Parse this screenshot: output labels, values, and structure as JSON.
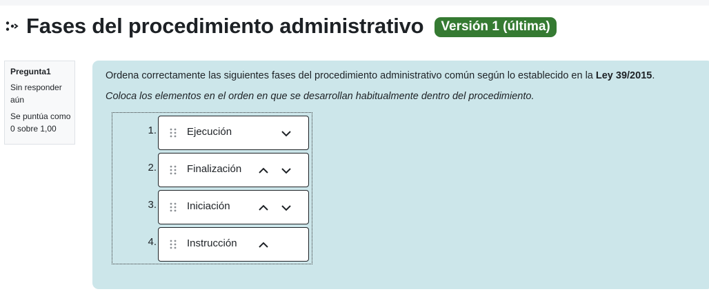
{
  "header": {
    "title": "Fases del procedimiento administrativo",
    "version_badge": "Versión 1 (última)",
    "icon": "drag-drop-question-icon"
  },
  "question_info": {
    "label": "Pregunta",
    "number": "1",
    "state": "Sin responder aún",
    "grade": "Se puntúa como 0 sobre 1,00"
  },
  "question": {
    "text_before": "Ordena correctamente las siguientes fases del procedimiento administrativo común según lo establecido en la ",
    "text_bold": "Ley 39/2015",
    "text_after": ".",
    "instruction": "Coloca los elementos en el orden en que se desarrollan habitualmente dentro del procedimiento."
  },
  "items": [
    {
      "index": "1.",
      "label": "Ejecución",
      "up": false,
      "down": true
    },
    {
      "index": "2.",
      "label": "Finalización",
      "up": true,
      "down": true
    },
    {
      "index": "3.",
      "label": "Iniciación",
      "up": true,
      "down": true
    },
    {
      "index": "4.",
      "label": "Instrucción",
      "up": true,
      "down": false
    }
  ],
  "colors": {
    "badge": "#357a32",
    "content_bg": "#cce6ea",
    "info_bg": "#f8f9fa"
  }
}
